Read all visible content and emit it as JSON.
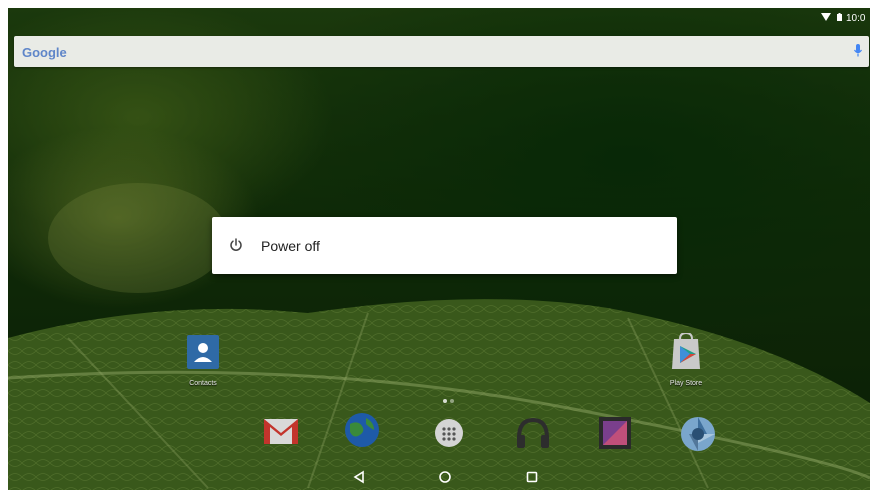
{
  "status_bar": {
    "clock": "10:0"
  },
  "search": {
    "logo": "Google"
  },
  "apps": {
    "contacts": "Contacts",
    "play_store": "Play Store"
  },
  "power_menu": {
    "power_off_label": "Power off"
  },
  "icons": {
    "wifi": "wifi-icon",
    "battery": "battery-icon",
    "mic": "mic-icon",
    "power": "power-icon",
    "gmail": "gmail-icon",
    "browser": "globe-icon",
    "app_drawer": "app-drawer-icon",
    "music": "headphones-icon",
    "gallery": "gallery-icon",
    "camera": "camera-icon",
    "back": "back-triangle-icon",
    "home": "home-circle-icon",
    "recents": "recents-square-icon"
  },
  "colors": {
    "accent_blue": "#4285f4",
    "dialog_bg": "#ffffff",
    "wallpaper_green": "#1d4410"
  }
}
